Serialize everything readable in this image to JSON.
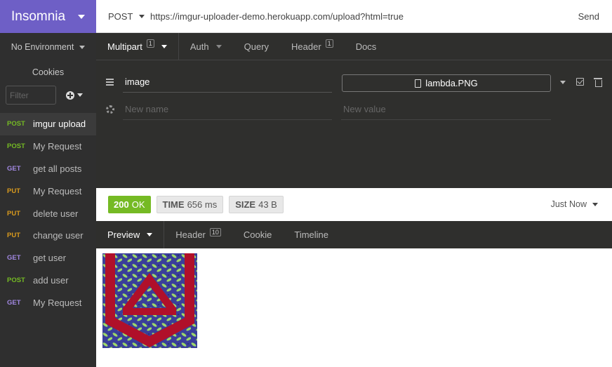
{
  "sidebar": {
    "brand": "Insomnia",
    "environment": "No Environment",
    "cookies_label": "Cookies",
    "filter_placeholder": "Filter",
    "requests": [
      {
        "method": "POST",
        "name": "imgur upload"
      },
      {
        "method": "POST",
        "name": "My Request"
      },
      {
        "method": "GET",
        "name": "get all posts"
      },
      {
        "method": "PUT",
        "name": "My Request"
      },
      {
        "method": "PUT",
        "name": "delete user"
      },
      {
        "method": "PUT",
        "name": "change user"
      },
      {
        "method": "GET",
        "name": "get user"
      },
      {
        "method": "POST",
        "name": "add user"
      },
      {
        "method": "GET",
        "name": "My Request"
      }
    ]
  },
  "urlbar": {
    "method": "POST",
    "url": "https://imgur-uploader-demo.herokuapp.com/upload?html=true",
    "send_label": "Send"
  },
  "request_tabs": {
    "multipart": "Multipart",
    "multipart_count": "1",
    "auth": "Auth",
    "query": "Query",
    "header": "Header",
    "header_count": "1",
    "docs": "Docs"
  },
  "params": {
    "name": "image",
    "file": "lambda.PNG",
    "new_name_placeholder": "New name",
    "new_value_placeholder": "New value"
  },
  "response": {
    "status_code": "200",
    "status_text": "OK",
    "time_label": "TIME",
    "time_value": "656 ms",
    "size_label": "SIZE",
    "size_value": "43 B",
    "when": "Just Now"
  },
  "response_tabs": {
    "preview": "Preview",
    "header": "Header",
    "header_count": "10",
    "cookie": "Cookie",
    "timeline": "Timeline"
  },
  "colors": {
    "brand": "#6e5fc6",
    "post": "#75ba24",
    "get": "#a087e0",
    "put": "#d89a1e",
    "ok": "#75ba24"
  }
}
